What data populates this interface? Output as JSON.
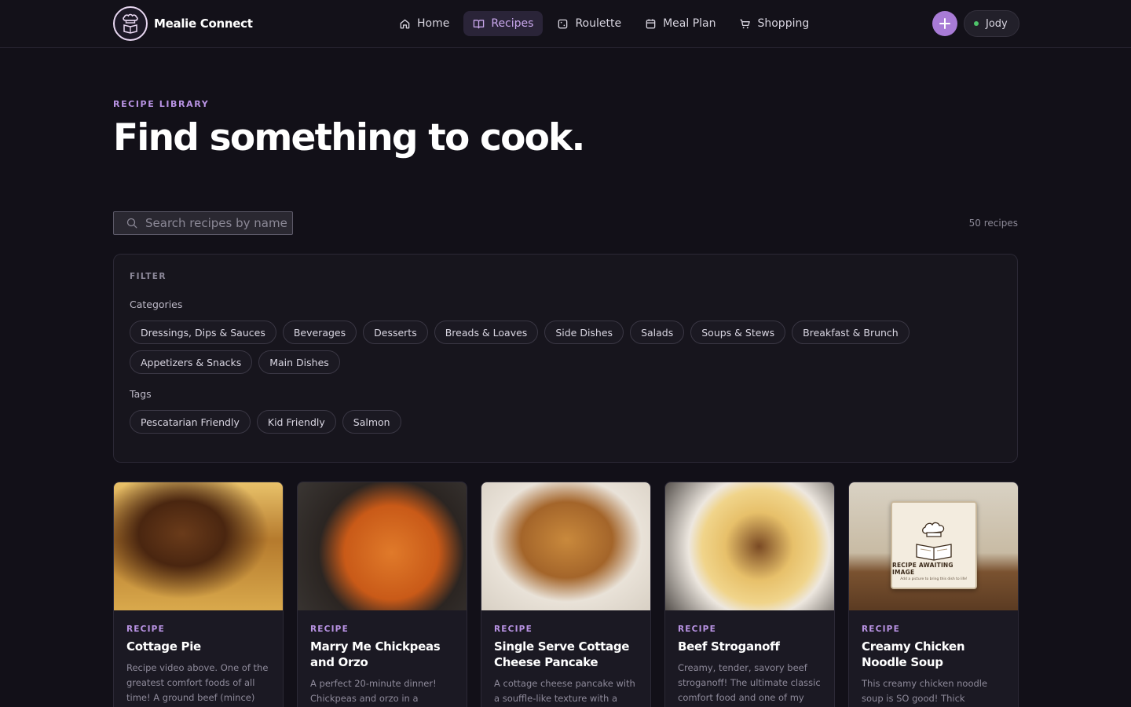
{
  "header": {
    "brand": "Mealie Connect",
    "nav": [
      {
        "label": "Home",
        "icon": "home-icon"
      },
      {
        "label": "Recipes",
        "icon": "book-icon",
        "active": true
      },
      {
        "label": "Roulette",
        "icon": "dice-icon"
      },
      {
        "label": "Meal Plan",
        "icon": "calendar-icon"
      },
      {
        "label": "Shopping",
        "icon": "cart-icon"
      }
    ],
    "user": "Jody"
  },
  "hero": {
    "eyebrow": "RECIPE LIBRARY",
    "title": "Find something to cook."
  },
  "search": {
    "placeholder": "Search recipes by name",
    "count": "50 recipes"
  },
  "filter": {
    "title": "FILTER",
    "categories_label": "Categories",
    "categories": [
      "Dressings, Dips & Sauces",
      "Beverages",
      "Desserts",
      "Breads & Loaves",
      "Side Dishes",
      "Salads",
      "Soups & Stews",
      "Breakfast & Brunch",
      "Appetizers & Snacks",
      "Main Dishes"
    ],
    "tags_label": "Tags",
    "tags": [
      "Pescatarian Friendly",
      "Kid Friendly",
      "Salmon"
    ]
  },
  "cards": [
    {
      "kicker": "RECIPE",
      "title": "Cottage Pie",
      "desc": "Recipe video above. One of the greatest comfort foods of all time! A ground beef (mince) filling in a"
    },
    {
      "kicker": "RECIPE",
      "title": "Marry Me Chickpeas and Orzo",
      "desc": "A perfect 20-minute dinner! Chickpeas and orzo in a luscious,"
    },
    {
      "kicker": "RECIPE",
      "title": "Single Serve Cottage Cheese Pancake",
      "desc": "A cottage cheese pancake with a souffle-like texture with a golden,"
    },
    {
      "kicker": "RECIPE",
      "title": "Beef Stroganoff",
      "desc": "Creamy, tender, savory beef stroganoff! The ultimate classic comfort food and one of my"
    },
    {
      "kicker": "RECIPE",
      "title": "Creamy Chicken Noodle Soup",
      "desc": "This creamy chicken noodle soup is SO good! Thick noodles, tender",
      "placeholder_title": "RECIPE AWAITING IMAGE",
      "placeholder_sub": "Add a picture to bring this dish to life!"
    }
  ]
}
